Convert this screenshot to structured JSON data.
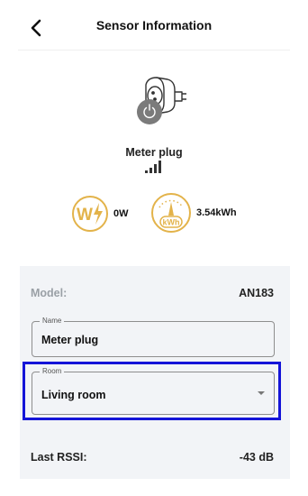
{
  "header": {
    "title": "Sensor Information"
  },
  "device": {
    "name": "Meter plug",
    "signal_level": 3,
    "signal_max": 4
  },
  "metrics": {
    "power_icon_text": "W",
    "power_value": "0W",
    "energy_icon_text": "kWh",
    "energy_value": "3.54kWh",
    "accent_color": "#e3b34a"
  },
  "info": {
    "model_label": "Model:",
    "model_value": "AN183",
    "name_field": {
      "legend": "Name",
      "value": "Meter plug"
    },
    "room_field": {
      "legend": "Room",
      "value": "Living room"
    },
    "rssi_label": "Last RSSI:",
    "rssi_value": "-43 dB"
  },
  "highlight_color": "#1414d8"
}
